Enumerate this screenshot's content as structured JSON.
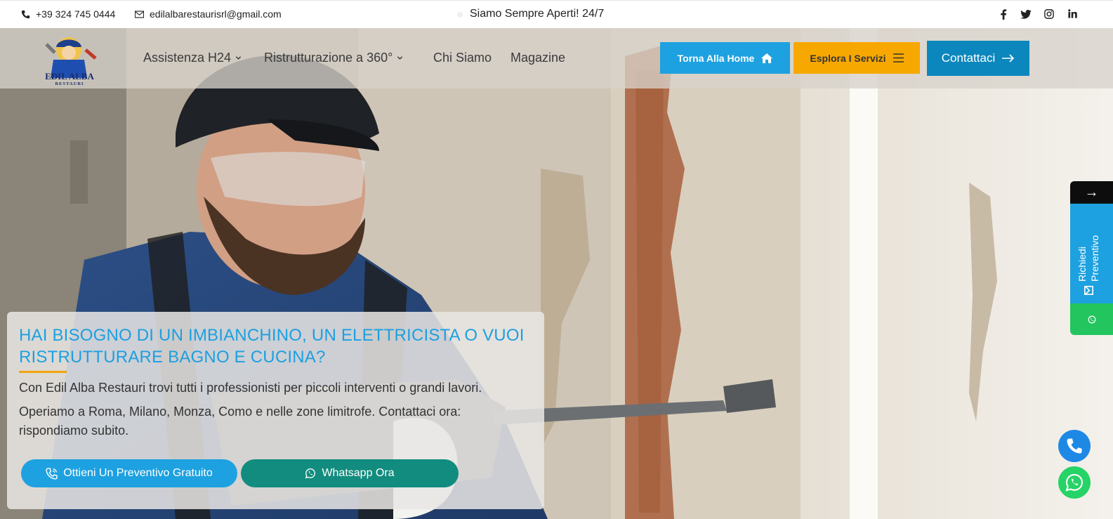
{
  "topbar": {
    "phone": "+39 324 745 0444",
    "email": "edilalbarestaurisrl@gmail.com",
    "tagline": "Siamo Sempre Aperti! 24/7",
    "social": [
      "facebook-icon",
      "twitter-icon",
      "instagram-icon",
      "linkedin-icon"
    ]
  },
  "logo": {
    "line1": "EDIL ALBA",
    "line2": "RESTAURI"
  },
  "nav": {
    "items": [
      {
        "label": "Assistenza H24",
        "has_dropdown": true
      },
      {
        "label": "Ristrutturazione a 360°",
        "has_dropdown": true
      },
      {
        "label": "Chi Siamo",
        "has_dropdown": false
      },
      {
        "label": "Magazine",
        "has_dropdown": false
      }
    ],
    "home_button": "Torna Alla Home",
    "services_button": "Esplora I Servizi",
    "contact_button": "Contattaci"
  },
  "hero": {
    "heading": "HAI BISOGNO DI UN IMBIANCHINO, UN ELETTRICISTA O VUOI RISTRUTTURARE BAGNO E CUCINA?",
    "paragraph1": "Con Edil Alba Restauri trovi tutti i professionisti per piccoli interventi o grandi lavori.",
    "paragraph2": "Operiamo a Roma, Milano, Monza, Como e nelle zone limitrofe. Contattaci ora: rispondiamo subito.",
    "quote_button": "Ottieni Un Preventivo Gratuito",
    "whatsapp_button": "Whatsapp Ora"
  },
  "side_tab": {
    "arrow": "→",
    "label": "Richiedi Preventivo"
  },
  "colors": {
    "accent_blue": "#1da1e0",
    "accent_orange": "#f7a800",
    "whatsapp_green": "#25d366",
    "dark_blue": "#0c87bd"
  }
}
